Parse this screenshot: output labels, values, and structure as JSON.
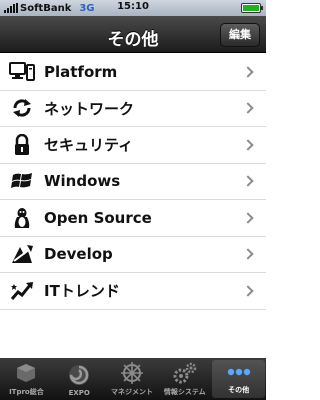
{
  "status_bar": {
    "carrier": "SoftBank",
    "network": "3G",
    "time": "15:10",
    "battery_level": 1.0
  },
  "nav": {
    "title": "その他",
    "edit_label": "編集"
  },
  "list": {
    "items": [
      {
        "label": "Platform",
        "icon": "computer-icon"
      },
      {
        "label": "ネットワーク",
        "icon": "network-icon"
      },
      {
        "label": "セキュリティ",
        "icon": "lock-icon"
      },
      {
        "label": "Windows",
        "icon": "windows-icon"
      },
      {
        "label": "Open Source",
        "icon": "penguin-icon"
      },
      {
        "label": "Develop",
        "icon": "develop-icon"
      },
      {
        "label": "ITトレンド",
        "icon": "trend-icon"
      }
    ]
  },
  "tab_bar": {
    "tabs": [
      {
        "label": "ITpro総合",
        "icon": "cube-icon"
      },
      {
        "label": "EXPO",
        "icon": "swirl-icon"
      },
      {
        "label": "マネジメント",
        "icon": "wheel-icon"
      },
      {
        "label": "情報システム",
        "icon": "gears-icon"
      },
      {
        "label": "その他",
        "icon": "more-icon",
        "selected": true
      }
    ]
  },
  "colors": {
    "nav_bar": "#2a2a2a",
    "battery": "#22b122",
    "network": "#2b5fc7",
    "separator": "#dcdcdc"
  }
}
